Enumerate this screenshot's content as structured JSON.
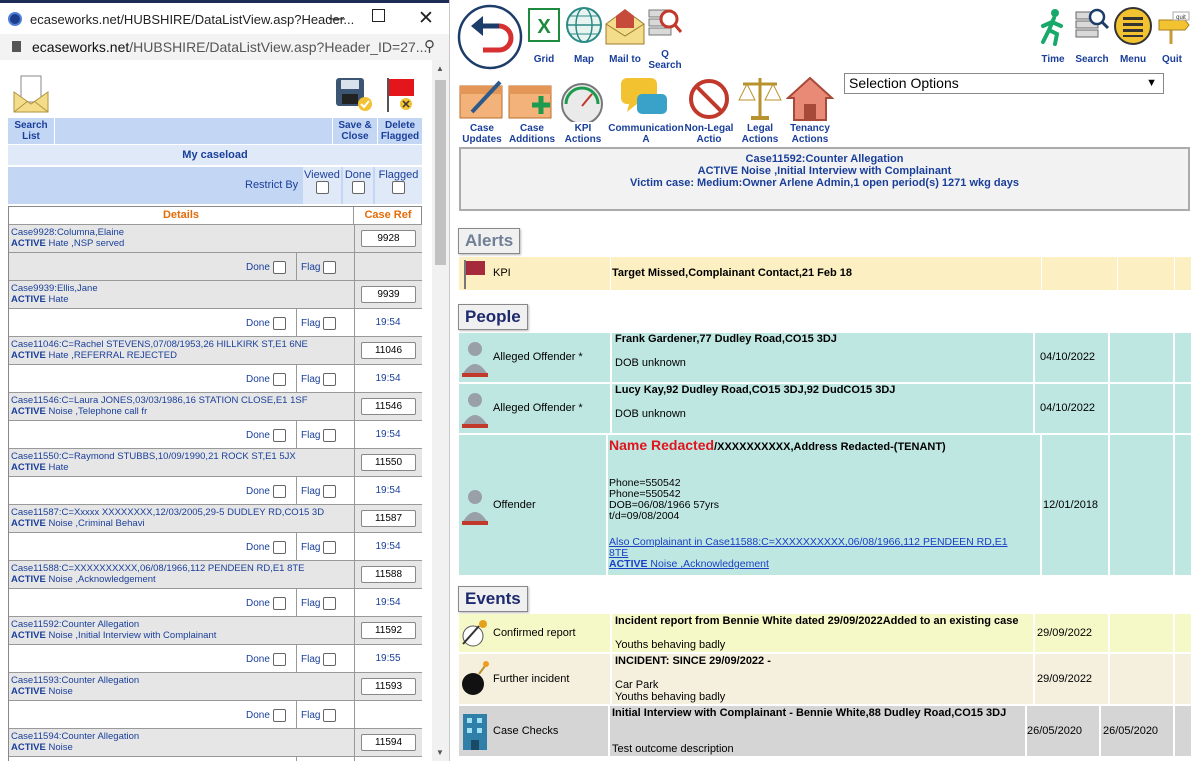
{
  "window": {
    "title": "ecaseworks.net/HUBSHIRE/DataListView.asp?Header...",
    "url_host": "ecaseworks.net",
    "url_path": "/HUBSHIRE/DataListView.asp?Header_ID=27..."
  },
  "left_toolbar": {
    "search_list": "Search List",
    "save_close": "Save & Close",
    "delete_flagged": "Delete Flagged"
  },
  "caseload": {
    "title": "My caseload",
    "restrict_by": "Restrict By",
    "viewed": "Viewed",
    "done": "Done",
    "flagged": "Flagged"
  },
  "table": {
    "details_header": "Details",
    "caseref_header": "Case Ref",
    "done_label": "Done",
    "flag_label": "Flag",
    "rows": [
      {
        "line1": "Case9928:Columna,Elaine",
        "status": "ACTIVE",
        "line2": " Hate ,NSP served",
        "ref": "9928",
        "time": ""
      },
      {
        "line1": "Case9939:Ellis,Jane",
        "status": "ACTIVE",
        "line2": " Hate",
        "ref": "9939",
        "time": "19:54"
      },
      {
        "line1": "Case11046:C=Rachel STEVENS,07/08/1953,26 HILLKIRK ST,E1 6NE",
        "status": "ACTIVE",
        "line2": " Hate ,REFERRAL REJECTED",
        "ref": "11046",
        "time": "19:54"
      },
      {
        "line1": "Case11546:C=Laura JONES,03/03/1986,16 STATION CLOSE,E1 1SF",
        "status": "ACTIVE",
        "line2": " Noise ,Telephone call fr",
        "ref": "11546",
        "time": "19:54"
      },
      {
        "line1": "Case11550:C=Raymond STUBBS,10/09/1990,21 ROCK ST,E1 5JX",
        "status": "ACTIVE",
        "line2": " Hate",
        "ref": "11550",
        "time": "19:54"
      },
      {
        "line1": "Case11587:C=Xxxxx XXXXXXXX,12/03/2005,29-5 DUDLEY RD,CO15 3D",
        "status": "ACTIVE",
        "line2": " Noise ,Criminal Behavi",
        "ref": "11587",
        "time": "19:54"
      },
      {
        "line1": "Case11588:C=XXXXXXXXXX,06/08/1966,112 PENDEEN RD,E1 8TE",
        "status": "ACTIVE",
        "line2": " Noise ,Acknowledgement",
        "ref": "11588",
        "time": "19:54"
      },
      {
        "line1": "Case11592:Counter Allegation",
        "status": "ACTIVE",
        "line2": " Noise ,Initial Interview with Complainant",
        "ref": "11592",
        "time": "19:55"
      },
      {
        "line1": "Case11593:Counter Allegation",
        "status": "ACTIVE",
        "line2": " Noise",
        "ref": "11593",
        "time": ""
      },
      {
        "line1": "Case11594:Counter Allegation",
        "status": "ACTIVE",
        "line2": " Noise",
        "ref": "11594",
        "time": ""
      }
    ]
  },
  "top_toolbar": {
    "grid": "Grid",
    "map": "Map",
    "mail_to": "Mail to",
    "q_search": "Q Search",
    "time": "Time",
    "search": "Search",
    "menu": "Menu",
    "quit": "Quit",
    "quit_sign": "quit"
  },
  "action_toolbar": {
    "case_updates": "Case Updates",
    "case_additions": "Case Additions",
    "kpi_actions": "KPI Actions",
    "communication": "Communication A",
    "non_legal": "Non-Legal Actio",
    "legal": "Legal Actions",
    "tenancy": "Tenancy Actions"
  },
  "selection": {
    "value": "Selection Options"
  },
  "case_header": {
    "line1": "Case11592:Counter Allegation",
    "line2": "ACTIVE Noise ,Initial Interview with Complainant",
    "line3": "Victim case: Medium:Owner Arlene Admin,1 open period(s) 1271 wkg days"
  },
  "alerts": {
    "title": "Alerts",
    "kpi_label": "KPI",
    "kpi_text": "Target Missed,Complainant Contact,21 Feb 18"
  },
  "people": {
    "title": "People",
    "p1": {
      "role": "Alleged Offender *",
      "name": "Frank Gardener,77 Dudley Road,CO15 3DJ",
      "dob": "DOB unknown",
      "date": "04/10/2022"
    },
    "p2": {
      "role": "Alleged Offender *",
      "name": "Lucy Kay,92 Dudley Road,CO15 3DJ,92 DudCO15 3DJ",
      "dob": "DOB unknown",
      "date": "04/10/2022"
    },
    "p3": {
      "role": "Offender",
      "name_red": "Name Redacted",
      "name_rest": "/XXXXXXXXXX,Address Redacted-(TENANT)",
      "phone1": "Phone=550542",
      "phone2": "Phone=550542",
      "dob": "DOB=06/08/1966 57yrs",
      "td": "t/d=09/08/2004",
      "also": "Also Complainant in Case11588:C=XXXXXXXXXX,06/08/1966,112 PENDEEN RD,E1 8TE",
      "also_status": "ACTIVE",
      "also_rest": " Noise ,Acknowledgement",
      "date": "12/01/2018"
    }
  },
  "events": {
    "title": "Events",
    "e1": {
      "type": "Confirmed report",
      "title": "Incident report from Bennie White dated 29/09/2022Added to an existing case",
      "desc": "Youths behaving badly",
      "date": "29/09/2022"
    },
    "e2": {
      "type": "Further incident",
      "title": "INCIDENT: SINCE 29/09/2022 -",
      "line2": "Car Park",
      "desc": "Youths behaving badly",
      "date": "29/09/2022"
    },
    "e3": {
      "type": "Case Checks",
      "title": "Initial Interview with Complainant - Bennie White,88 Dudley Road,CO15 3DJ",
      "desc": "Test outcome description",
      "date1": "26/05/2020",
      "date2": "26/05/2020"
    }
  }
}
